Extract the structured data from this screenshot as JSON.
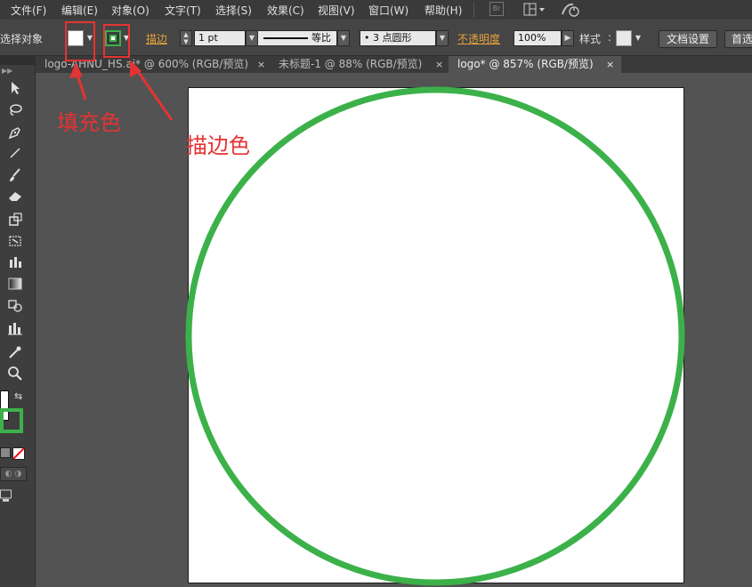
{
  "menu": {
    "items": [
      "文件(F)",
      "编辑(E)",
      "对象(O)",
      "文字(T)",
      "选择(S)",
      "效果(C)",
      "视图(V)",
      "窗口(W)",
      "帮助(H)"
    ],
    "bridge_badge": "Br",
    "arrange_icon": "arrange-documents-icon",
    "sync_icon": "sync-settings-icon"
  },
  "control": {
    "selection_label": "选择对象",
    "fill_color": "#ffffff",
    "stroke_color": "#3cb14a",
    "stroke_label": "描边",
    "stroke_weight": "1 pt",
    "profile_label": "等比",
    "brush_label": "• 3 点圆形",
    "opacity_label": "不透明度",
    "opacity_value": "100%",
    "style_label": "样式",
    "doc_setup_button": "文档设置",
    "prefs_button": "首选"
  },
  "tabs": [
    {
      "label": "logo-AHNU_HS.ai* @ 600% (RGB/预览)",
      "close": "×",
      "active": false
    },
    {
      "label": "未标题-1 @ 88% (RGB/预览)",
      "close": "×",
      "active": false
    },
    {
      "label": "logo* @ 857% (RGB/预览)",
      "close": "×",
      "active": true
    }
  ],
  "toolbox": {
    "tools": [
      "selection-tool-icon",
      "lasso-tool-icon",
      "pen-tool-icon",
      "line-tool-icon",
      "paintbrush-tool-icon",
      "eraser-tool-icon",
      "rotate-tool-icon",
      "free-transform-tool-icon",
      "graph-tool-icon",
      "gradient-tool-icon",
      "blend-tool-icon",
      "column-graph-tool-icon",
      "eyedropper-tool-icon",
      "zoom-tool-icon"
    ]
  },
  "canvas": {
    "circle_stroke_color": "#3cb14a"
  },
  "annotations": {
    "fill_label": "填充色",
    "stroke_label": "描边色",
    "color": "#e53333"
  }
}
